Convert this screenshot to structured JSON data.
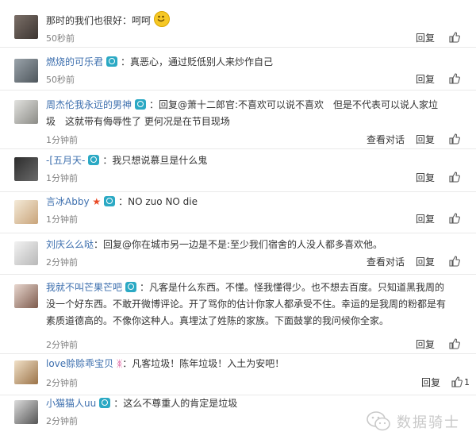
{
  "comments": [
    {
      "user": "",
      "text": "那时的我们也很好：呵呵",
      "time": "50秒前",
      "actions": [
        "回复"
      ],
      "like_count": "",
      "badge": false,
      "emoji": "smile"
    },
    {
      "user": "燃烧的可乐君",
      "text": "：真恶心，通过贬低别人来炒作自己",
      "time": "50秒前",
      "actions": [
        "回复"
      ],
      "like_count": "",
      "badge": true
    },
    {
      "user": "周杰伦我永远的男神",
      "text": "：回复@萧十二郎官:不喜欢可以说不喜欢　但是不代表可以说人家垃圾　这就带有侮辱性了 更何况是在节目现场",
      "time": "1分钟前",
      "actions": [
        "查看对话",
        "回复"
      ],
      "like_count": "",
      "badge": true
    },
    {
      "user": "-[五月天-",
      "text": "：我只想说慕旦是什么鬼",
      "time": "1分钟前",
      "actions": [
        "回复"
      ],
      "like_count": "",
      "badge": true
    },
    {
      "user": "言冰Abby",
      "text": "：NO zuo NO die",
      "time": "1分钟前",
      "actions": [
        "回复"
      ],
      "like_count": "",
      "badge": true,
      "star": true
    },
    {
      "user": "刘庆么么哒",
      "text": "：回复@你在城市另一边是不是:至少我们宿舍的人没人都多喜欢他。",
      "time": "2分钟前",
      "actions": [
        "查看对话",
        "回复"
      ],
      "like_count": "",
      "badge": false
    },
    {
      "user": "我就不叫芒果芒吧",
      "text": "：凡客是什么东西。不懂。怪我懂得少。也不想去百度。只知道黑我周的没一个好东西。不敢开微博评论。开了骂你的估计你家人都承受不住。幸运的是我周的粉都是有素质道德高的。不像你这种人。真埋汰了姓陈的家族。下面鼓掌的我问候你全家。",
      "time": "2分钟前",
      "actions": [
        "回复"
      ],
      "like_count": "",
      "badge": true
    },
    {
      "user": "love赊赊乖宝贝",
      "text": "：凡客垃圾！陈年垃圾！入土为安吧！",
      "time": "2分钟前",
      "actions": [
        "回复"
      ],
      "like_count": "1",
      "badge": false,
      "butterfly": true
    },
    {
      "user": "小猫猫人uu",
      "text": "：这么不尊重人的肯定是垃圾",
      "time": "2分钟前",
      "actions": [],
      "like_count": "",
      "badge": true
    }
  ],
  "watermark": "数据骑士",
  "icons": {
    "like": "thumbs-up-icon",
    "badge": "camera-badge-icon",
    "watermark": "wechat-icon"
  },
  "colors": {
    "username": "#3d6fae",
    "badge": "#2ba9c4",
    "time": "#808080"
  }
}
